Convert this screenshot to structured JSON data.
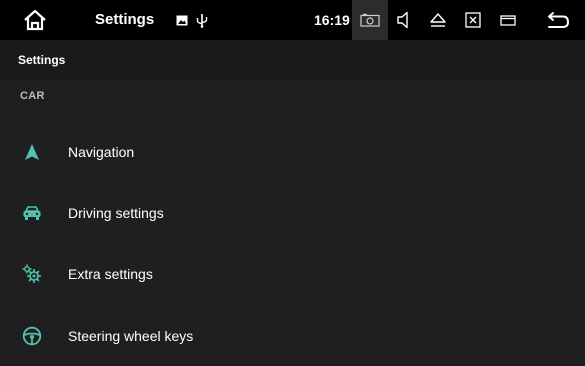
{
  "statusbar": {
    "title": "Settings",
    "time": "16:19",
    "icons": {
      "home": "home-icon",
      "picture": "picture-icon",
      "usb": "usb-icon",
      "camera": "camera-icon",
      "volume": "volume-icon",
      "eject": "eject-icon",
      "close_window": "close-window-icon",
      "window": "window-icon",
      "back": "back-icon"
    }
  },
  "subheader": {
    "title": "Settings"
  },
  "section": {
    "header": "CAR"
  },
  "items": [
    {
      "label": "Navigation",
      "icon": "navigation-arrow-icon"
    },
    {
      "label": "Driving settings",
      "icon": "car-icon"
    },
    {
      "label": "Extra settings",
      "icon": "gears-icon"
    },
    {
      "label": "Steering wheel keys",
      "icon": "steering-wheel-icon"
    }
  ],
  "colors": {
    "accent": "#4fc3b0",
    "statusbar_bg": "#000000",
    "subheader_bg": "#1a1a1a",
    "content_bg": "#1f1f1f"
  }
}
